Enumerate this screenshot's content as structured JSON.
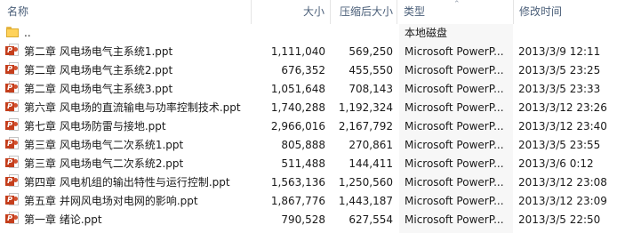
{
  "columns": {
    "name": "名称",
    "size": "大小",
    "compressed": "压缩后大小",
    "type": "类型",
    "modified": "修改时间"
  },
  "sort_icon": "chevron-up-icon",
  "parent_row": {
    "name": "..",
    "type": "本地磁盘"
  },
  "files": [
    {
      "name": "第二章 风电场电气主系统1.ppt",
      "size": "1,111,040",
      "compressed": "569,250",
      "type": "Microsoft PowerP...",
      "modified": "2013/3/9 12:11"
    },
    {
      "name": "第二章 风电场电气主系统2.ppt",
      "size": "676,352",
      "compressed": "455,550",
      "type": "Microsoft PowerP...",
      "modified": "2013/3/5 23:25"
    },
    {
      "name": "第二章 风电场电气主系统3.ppt",
      "size": "1,051,648",
      "compressed": "708,143",
      "type": "Microsoft PowerP...",
      "modified": "2013/3/5 23:33"
    },
    {
      "name": "第六章 风电场的直流输电与功率控制技术.ppt",
      "size": "1,740,288",
      "compressed": "1,192,324",
      "type": "Microsoft PowerP...",
      "modified": "2013/3/12 23:26"
    },
    {
      "name": "第七章 风电场防雷与接地.ppt",
      "size": "2,966,016",
      "compressed": "2,167,792",
      "type": "Microsoft PowerP...",
      "modified": "2013/3/12 23:40"
    },
    {
      "name": "第三章 风电场电气二次系统1.ppt",
      "size": "805,888",
      "compressed": "270,861",
      "type": "Microsoft PowerP...",
      "modified": "2013/3/5 23:55"
    },
    {
      "name": "第三章 风电场电气二次系统2.ppt",
      "size": "511,488",
      "compressed": "144,411",
      "type": "Microsoft PowerP...",
      "modified": "2013/3/6 0:12"
    },
    {
      "name": "第四章 风电机组的输出特性与运行控制.ppt",
      "size": "1,563,136",
      "compressed": "1,250,560",
      "type": "Microsoft PowerP...",
      "modified": "2013/3/12 23:08"
    },
    {
      "name": "第五章 并网风电场对电网的影响.ppt",
      "size": "1,867,776",
      "compressed": "1,443,187",
      "type": "Microsoft PowerP...",
      "modified": "2013/3/12 23:09"
    },
    {
      "name": "第一章 绪论.ppt",
      "size": "790,528",
      "compressed": "627,554",
      "type": "Microsoft PowerP...",
      "modified": "2013/3/5 22:50"
    }
  ],
  "file_icon": "ppt-file-icon",
  "folder_icon": "folder-icon"
}
